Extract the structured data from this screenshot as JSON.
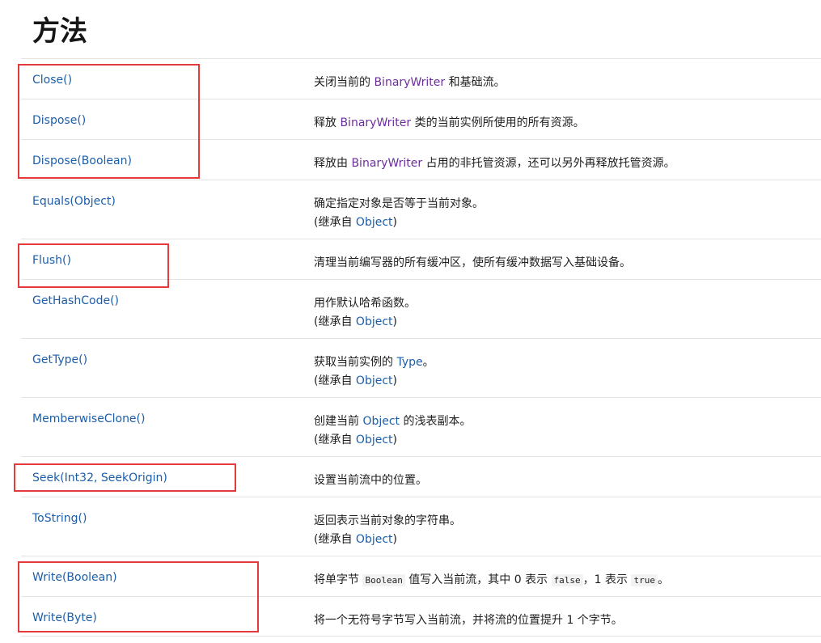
{
  "page": {
    "title": "方法"
  },
  "methods": [
    {
      "name": "Close()",
      "desc": {
        "pre": "关闭当前的 ",
        "link": "BinaryWriter",
        "post": " 和基础流。"
      }
    },
    {
      "name": "Dispose()",
      "desc": {
        "pre": "释放 ",
        "link": "BinaryWriter",
        "post": " 类的当前实例所使用的所有资源。"
      }
    },
    {
      "name": "Dispose(Boolean)",
      "desc": {
        "pre": "释放由 ",
        "link": "BinaryWriter",
        "post": " 占用的非托管资源，还可以另外再释放托管资源。"
      }
    },
    {
      "name": "Equals(Object)",
      "desc": {
        "text": "确定指定对象是否等于当前对象。"
      },
      "inherit": {
        "pre": "(继承自 ",
        "link": "Object",
        "post": ")"
      }
    },
    {
      "name": "Flush()",
      "desc": {
        "text": "清理当前编写器的所有缓冲区，使所有缓冲数据写入基础设备。"
      }
    },
    {
      "name": "GetHashCode()",
      "desc": {
        "text": "用作默认哈希函数。"
      },
      "inherit": {
        "pre": "(继承自 ",
        "link": "Object",
        "post": ")"
      }
    },
    {
      "name": "GetType()",
      "desc": {
        "pre": "获取当前实例的 ",
        "link": "Type",
        "post": "。"
      },
      "inherit": {
        "pre": "(继承自 ",
        "link": "Object",
        "post": ")"
      }
    },
    {
      "name": "MemberwiseClone()",
      "desc": {
        "pre": "创建当前 ",
        "link": "Object",
        "post": " 的浅表副本。"
      },
      "inherit": {
        "pre": "(继承自 ",
        "link": "Object",
        "post": ")"
      }
    },
    {
      "name": "Seek(Int32, SeekOrigin)",
      "desc": {
        "text": "设置当前流中的位置。"
      }
    },
    {
      "name": "ToString()",
      "desc": {
        "text": "返回表示当前对象的字符串。"
      },
      "inherit": {
        "pre": "(继承自 ",
        "link": "Object",
        "post": ")"
      }
    },
    {
      "name": "Write(Boolean)",
      "desc": {
        "t1": "将单字节 ",
        "c1": "Boolean",
        "t2": " 值写入当前流，其中 0 表示 ",
        "c2": "false",
        "t3": "，1 表示 ",
        "c3": "true",
        "t4": "。"
      }
    },
    {
      "name": "Write(Byte)",
      "desc": {
        "text": "将一个无符号字节写入当前流，并将流的位置提升 1 个字节。"
      }
    }
  ],
  "colors": {
    "link": "#1c5ea9",
    "type_link": "#6b2d9c",
    "highlight": "#e5393b"
  }
}
